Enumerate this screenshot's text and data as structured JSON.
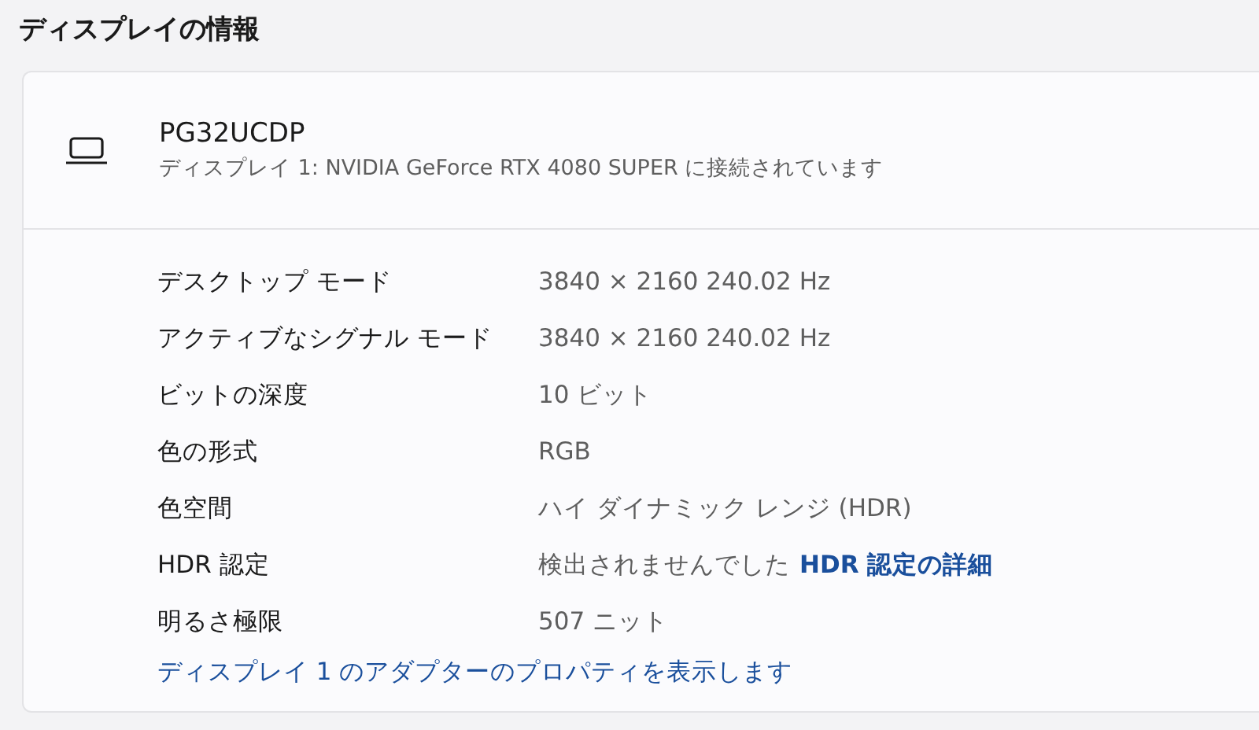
{
  "section_title": "ディスプレイの情報",
  "display": {
    "name": "PG32UCDP",
    "subtitle": "ディスプレイ 1: NVIDIA GeForce RTX 4080 SUPER に接続されています"
  },
  "properties": [
    {
      "label": "デスクトップ モード",
      "value": "3840 × 2160 240.02 Hz"
    },
    {
      "label": "アクティブなシグナル モード",
      "value": "3840 × 2160 240.02 Hz"
    },
    {
      "label": "ビットの深度",
      "value": "10 ビット"
    },
    {
      "label": "色の形式",
      "value": "RGB"
    },
    {
      "label": "色空間",
      "value": "ハイ ダイナミック レンジ (HDR)"
    },
    {
      "label": "HDR 認定",
      "value": "検出されませんでした",
      "link": "HDR 認定の詳細"
    },
    {
      "label": "明るさ極限",
      "value": "507 ニット"
    }
  ],
  "adapter_link": "ディスプレイ 1 のアダプターのプロパティを表示します"
}
